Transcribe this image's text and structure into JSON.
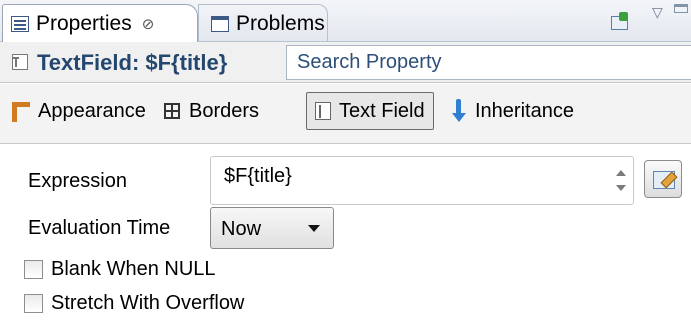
{
  "tabs": [
    {
      "label": "Properties",
      "close": "⊘",
      "active": true
    },
    {
      "label": "Problems",
      "active": false
    }
  ],
  "title": {
    "text": "TextField: $F{title}",
    "search_placeholder": "Search Property"
  },
  "sections": [
    {
      "label": "Appearance",
      "icon": "appearance-icon"
    },
    {
      "label": "Borders",
      "icon": "borders-icon"
    },
    {
      "label": "Text Field",
      "icon": "text-field-icon",
      "selected": true
    },
    {
      "label": "Inheritance",
      "icon": "inheritance-icon"
    }
  ],
  "form": {
    "expression_label": "Expression",
    "expression_value": "$F{title}",
    "evaluation_time_label": "Evaluation Time",
    "evaluation_time_value": "Now",
    "blank_when_null_label": "Blank When NULL",
    "stretch_with_overflow_label": "Stretch With Overflow"
  },
  "colors": {
    "title_text": "#24476f",
    "tab_bar_bg": "#e3e8ef",
    "section_bar_bg": "#f3f3f3"
  }
}
